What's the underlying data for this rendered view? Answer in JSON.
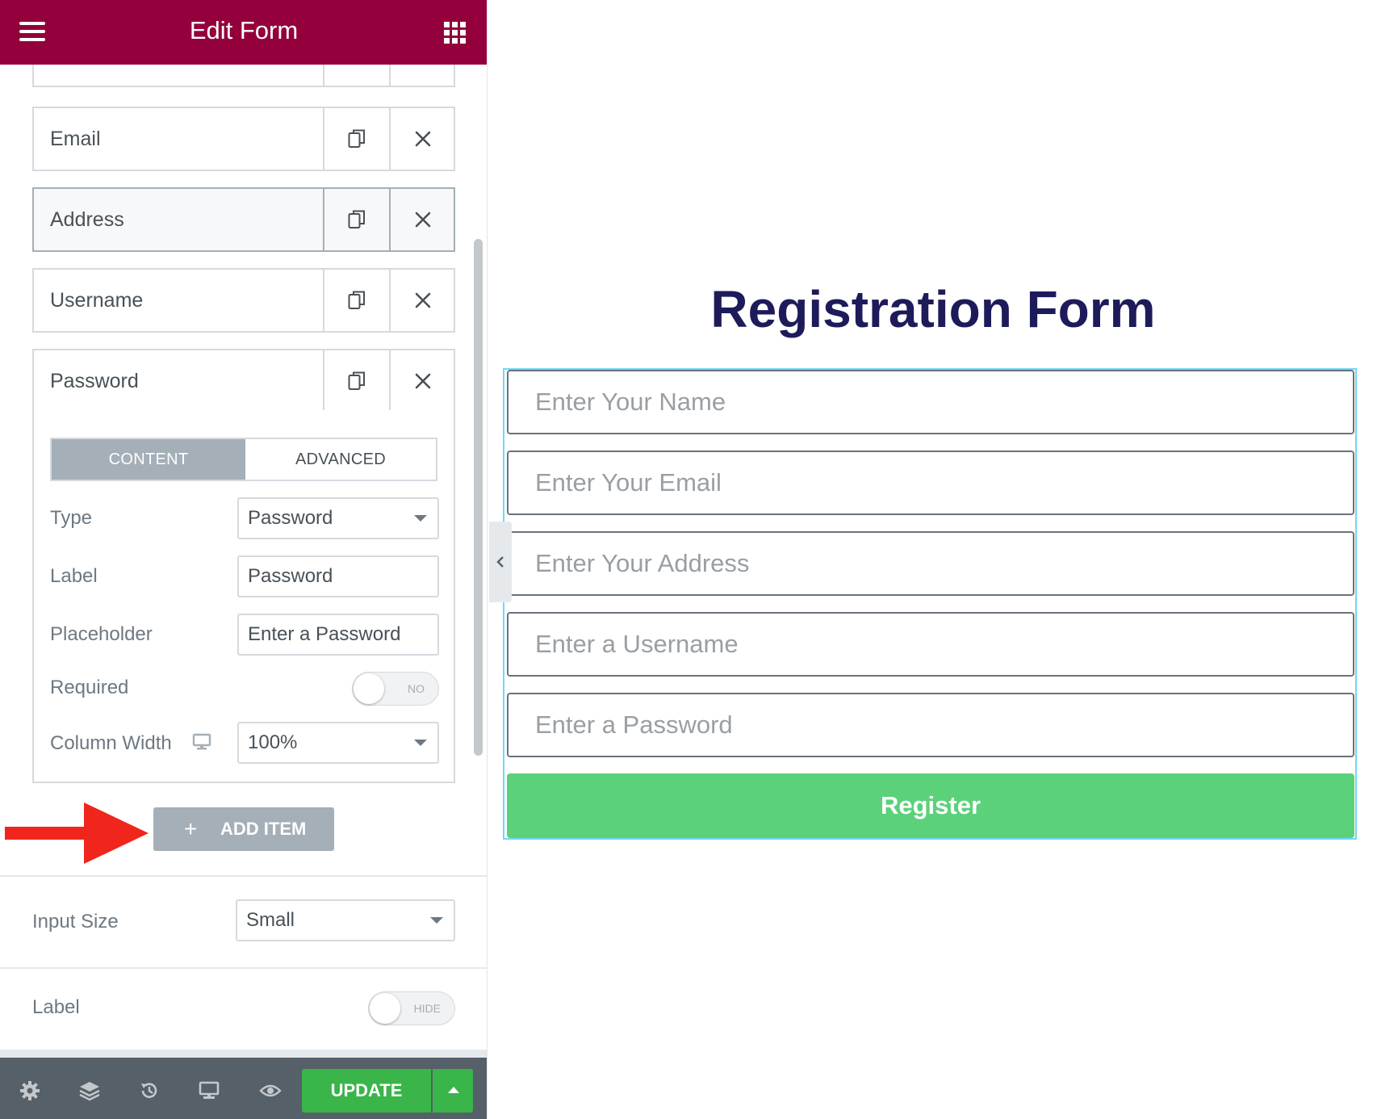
{
  "header": {
    "title": "Edit Form"
  },
  "form_fields": [
    {
      "label": "Email"
    },
    {
      "label": "Address"
    },
    {
      "label": "Username"
    },
    {
      "label": "Password"
    }
  ],
  "field_settings": {
    "tabs": [
      "CONTENT",
      "ADVANCED"
    ],
    "type": {
      "label": "Type",
      "value": "Password"
    },
    "field_label": {
      "label": "Label",
      "value": "Password"
    },
    "placeholder": {
      "label": "Placeholder",
      "value": "Enter a Password"
    },
    "required": {
      "label": "Required",
      "toggle_text": "NO"
    },
    "column_width": {
      "label": "Column Width",
      "value": "100%"
    }
  },
  "add_item": {
    "plus": "+",
    "label": "ADD ITEM"
  },
  "input_size": {
    "label": "Input Size",
    "value": "Small"
  },
  "label_switch": {
    "label": "Label",
    "toggle_text": "HIDE"
  },
  "footer": {
    "update_label": "UPDATE"
  },
  "preview": {
    "title": "Registration Form",
    "placeholders": [
      "Enter Your Name",
      "Enter Your Email",
      "Enter Your Address",
      "Enter a Username",
      "Enter a Password"
    ],
    "button_label": "Register"
  },
  "colors": {
    "header": "#93003c",
    "update": "#39b54a",
    "register": "#5bd17a",
    "title": "#1e1b5b",
    "annotation_arrow": "#f0261c"
  }
}
